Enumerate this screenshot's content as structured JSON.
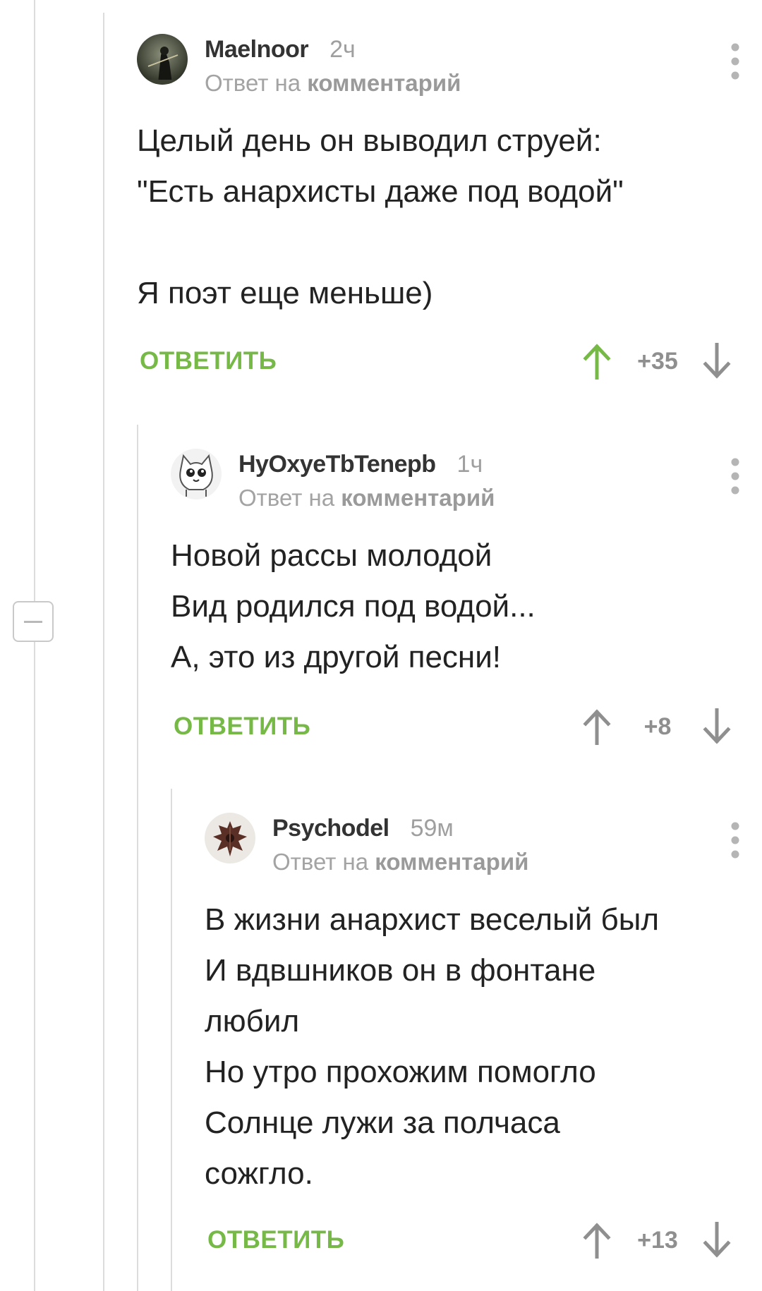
{
  "comments": [
    {
      "author": "Maelnoor",
      "time": "2ч",
      "reply_prefix": "Ответ на",
      "reply_target": "комментарий",
      "body": "Целый день он выводил струей:\n\"Есть анархисты даже под водой\"\n\nЯ поэт еще меньше)",
      "reply_label": "ОТВЕТИТЬ",
      "score": "+35",
      "upvoted": true
    },
    {
      "author": "HyOxyeTbTenepb",
      "time": "1ч",
      "reply_prefix": "Ответ на",
      "reply_target": "комментарий",
      "body": "Новой рассы молодой\nВид родился под водой...\nА, это из другой песни!",
      "reply_label": "ОТВЕТИТЬ",
      "score": "+8",
      "upvoted": false
    },
    {
      "author": "Psychodel",
      "time": "59м",
      "reply_prefix": "Ответ на",
      "reply_target": "комментарий",
      "body": "В жизни анархист веселый был\nИ вдвшников он в фонтане\nлюбил\nНо утро прохожим помогло\nСолнце лужи за полчаса\nсожгло.",
      "reply_label": "ОТВЕТИТЬ",
      "score": "+13",
      "upvoted": false
    }
  ],
  "icons": {
    "upvote": "arrow-up-icon",
    "downvote": "arrow-down-icon",
    "menu": "more-vertical-icon",
    "collapse": "minus-icon"
  },
  "colors": {
    "accent_green": "#76b947",
    "muted_text": "#a3a3a3",
    "score_gray": "#8f8f8f",
    "thread_line": "#dcdcdc"
  }
}
